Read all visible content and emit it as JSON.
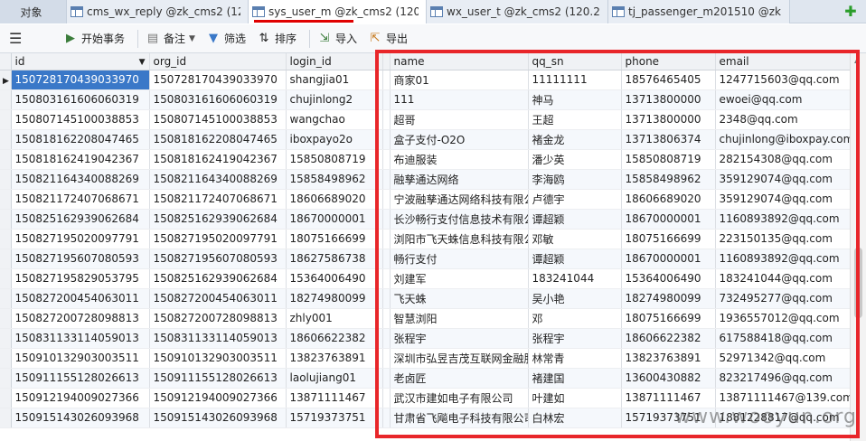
{
  "tabs": {
    "objects": "对象",
    "items": [
      {
        "label": "cms_wx_reply @zk_cms2 (12..."
      },
      {
        "label": "sys_user_m @zk_cms2 (120...."
      },
      {
        "label": "wx_user_t @zk_cms2 (120.2..."
      },
      {
        "label": "tj_passenger_m201510 @zk..."
      }
    ]
  },
  "toolbar": {
    "begin_transaction": "开始事务",
    "note": "备注",
    "filter": "筛选",
    "sort": "排序",
    "import": "导入",
    "export": "导出"
  },
  "grid": {
    "columns": [
      "id",
      "org_id",
      "login_id",
      "",
      "name",
      "qq_sn",
      "phone",
      "email"
    ],
    "rows": [
      [
        "150728170439033970",
        "150728170439033970",
        "shangjia01",
        "",
        "商家01",
        "11111111",
        "18576465405",
        "1247715603@qq.com"
      ],
      [
        "150803161606060319",
        "150803161606060319",
        "chujinlong2",
        "",
        "111",
        "神马",
        "13713800000",
        "ewoei@qq.com"
      ],
      [
        "150807145100038853",
        "150807145100038853",
        "wangchao",
        "",
        "超哥",
        "王超",
        "13713800000",
        "2348@qq.com"
      ],
      [
        "150818162208047465",
        "150818162208047465",
        "iboxpayo2o",
        "",
        "盒子支付-O2O",
        "褚金龙",
        "13713806374",
        "chujinlong@iboxpay.com"
      ],
      [
        "150818162419042367",
        "150818162419042367",
        "15850808719",
        "",
        "布迪服装",
        "潘少英",
        "15850808719",
        "282154308@qq.com"
      ],
      [
        "150821164340088269",
        "150821164340088269",
        "15858498962",
        "",
        "融孳通达网络",
        "李海鸥",
        "15858498962",
        "359129074@qq.com"
      ],
      [
        "150821172407068671",
        "150821172407068671",
        "18606689020",
        "",
        "宁波融孳通达网络科技有限公司",
        "卢德宇",
        "18606689020",
        "359129074@qq.com"
      ],
      [
        "150825162939062684",
        "150825162939062684",
        "18670000001",
        "",
        "长沙畅行支付信息技术有限公司",
        "谭超颖",
        "18670000001",
        "1160893892@qq.com"
      ],
      [
        "150827195020097791",
        "150827195020097791",
        "18075166699",
        "",
        "浏阳市飞天蛛信息科技有限公司",
        "邓敏",
        "18075166699",
        "223150135@qq.com"
      ],
      [
        "150827195607080593",
        "150827195607080593",
        "18627586738",
        "",
        "畅行支付",
        "谭超颖",
        "18670000001",
        "1160893892@qq.com"
      ],
      [
        "150827195829053795",
        "150825162939062684",
        "15364006490",
        "",
        "刘建军",
        "183241044",
        "15364006490",
        "183241044@qq.com"
      ],
      [
        "150827200454063011",
        "150827200454063011",
        "18274980099",
        "",
        "飞天蛛",
        "吴小艳",
        "18274980099",
        "732495277@qq.com"
      ],
      [
        "150827200728098813",
        "150827200728098813",
        "zhly001",
        "",
        "智慧浏阳",
        "邓",
        "18075166699",
        "1936557012@qq.com"
      ],
      [
        "150831133114059013",
        "150831133114059013",
        "18606622382",
        "",
        "张程宇",
        "张程宇",
        "18606622382",
        "617588418@qq.com"
      ],
      [
        "150910132903003511",
        "150910132903003511",
        "13823763891",
        "",
        "深圳市弘昱吉茂互联网金融服务有限公司",
        "林常青",
        "13823763891",
        "52971342@qq.com"
      ],
      [
        "150911155128026613",
        "150911155128026613",
        "laolujiang01",
        "",
        "老卤匠",
        "褚建国",
        "13600430882",
        "823217496@qq.com"
      ],
      [
        "150912194009027366",
        "150912194009027366",
        "13871111467",
        "",
        "武汉市建如电子有限公司",
        "叶建如",
        "13871111467",
        "13871111467@139.com"
      ],
      [
        "150915143026093968",
        "150915143026093968",
        "15719373751",
        "",
        "甘肃省飞飚电子科技有限公司",
        "白林宏",
        "15719373751",
        "1881228817@qq.com"
      ]
    ]
  },
  "watermark": "www.wooyun.org",
  "colors": {
    "highlight": "#e8262a",
    "selected": "#3a78c8"
  }
}
